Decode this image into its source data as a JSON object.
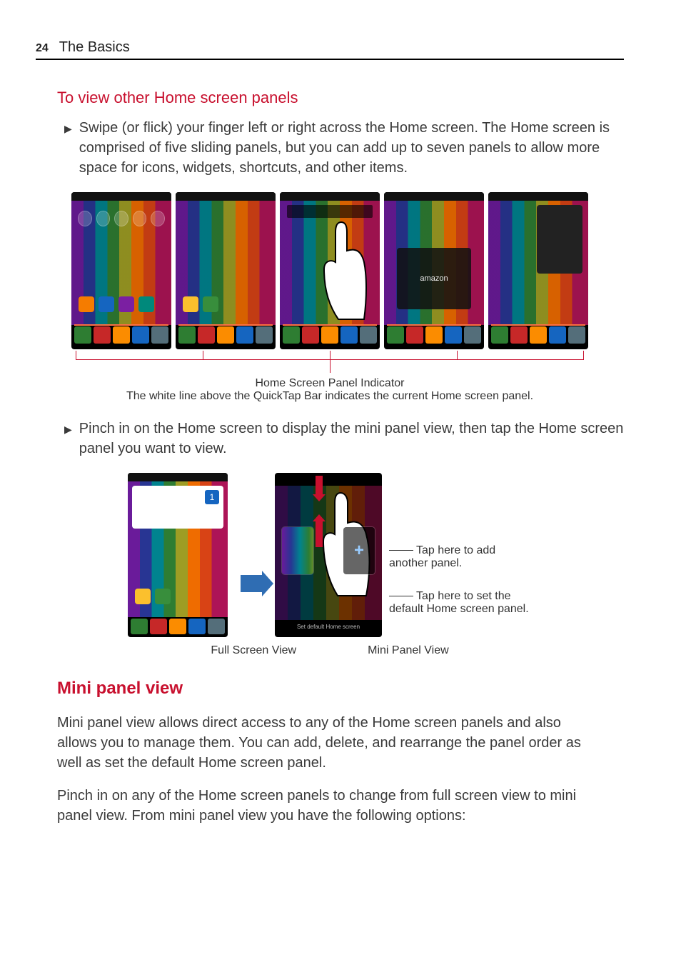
{
  "header": {
    "page_number": "24",
    "section_title": "The Basics"
  },
  "heading1": "To view other Home screen panels",
  "bullet1": "Swipe (or flick) your finger left or right across the Home screen. The Home screen is comprised of five sliding panels, but you can add up to seven panels to allow more space for icons, widgets, shortcuts, and other items.",
  "figure1": {
    "caption_title": "Home Screen Panel Indicator",
    "caption_body": "The white line above the QuickTap Bar indicates the current Home screen panel.",
    "widget_label": "amazon"
  },
  "bullet2": "Pinch in on the Home screen to display the mini panel view, then tap the Home screen panel you want to view.",
  "figure2": {
    "left_caption": "Full Screen View",
    "right_caption": "Mini Panel View",
    "annotation_add": "Tap here to add another panel.",
    "annotation_default": "Tap here to set the default Home screen panel.",
    "default_bar_text": "Set default Home screen",
    "weather_num": "1"
  },
  "heading2": "Mini panel view",
  "para1": "Mini panel view allows direct access to any of the Home screen panels and also allows you to manage them. You can add, delete, and rearrange the panel order as well as set the default Home screen panel.",
  "para2": "Pinch in on any of the Home screen panels to change from full screen view to mini panel view. From mini panel view you have the following options:",
  "quicktap_colors": [
    "#2e7d32",
    "#c62828",
    "#fb8c00",
    "#1565c0",
    "#546e7a"
  ]
}
